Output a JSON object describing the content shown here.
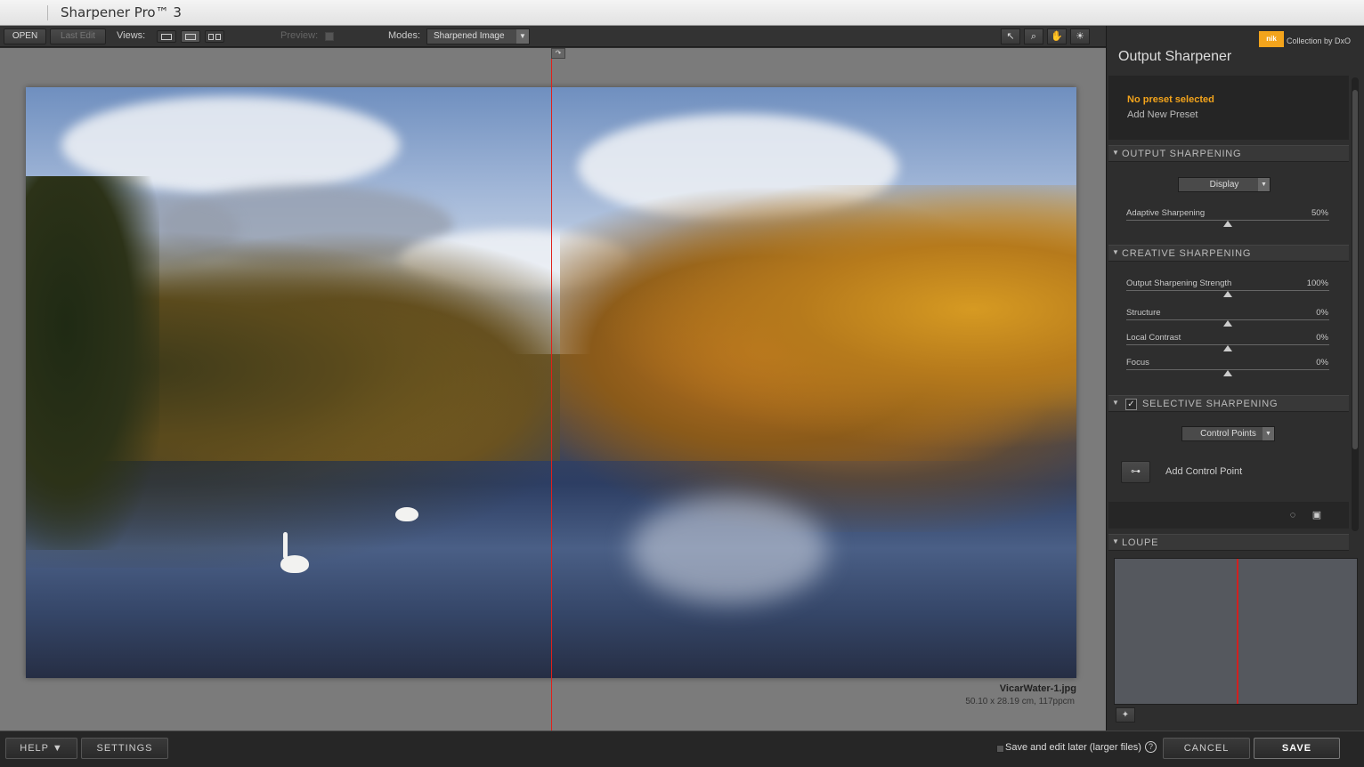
{
  "window": {
    "title": "Sharpener Pro™ 3"
  },
  "toolbar": {
    "open_label": "OPEN",
    "last_edit_label": "Last Edit",
    "views_label": "Views:",
    "preview_label": "Preview:",
    "modes_label": "Modes:",
    "modes_value": "Sharpened Image"
  },
  "canvas": {
    "file_name": "VicarWater-1.jpg",
    "file_info": "50.10 x 28.19 cm, 117ppcm"
  },
  "panel": {
    "brand_logo": "nik",
    "brand_collection": "Collection by DxO",
    "title": "Output Sharpener",
    "no_preset": "No preset selected",
    "add_preset": "Add New Preset",
    "output_sharpening": {
      "header": "OUTPUT SHARPENING",
      "select_value": "Display",
      "sliders": [
        {
          "label": "Adaptive Sharpening",
          "value": "50%",
          "fraction": 0.5
        }
      ]
    },
    "creative_sharpening": {
      "header": "CREATIVE SHARPENING",
      "sliders": [
        {
          "label": "Output Sharpening Strength",
          "value": "100%",
          "fraction": 0.5
        },
        {
          "label": "Structure",
          "value": "0%",
          "fraction": 0.5
        },
        {
          "label": "Local Contrast",
          "value": "0%",
          "fraction": 0.5
        },
        {
          "label": "Focus",
          "value": "0%",
          "fraction": 0.5
        }
      ]
    },
    "selective_sharpening": {
      "header": "SELECTIVE SHARPENING",
      "checked": true,
      "select_value": "Control Points",
      "add_control_point": "Add Control Point"
    },
    "loupe": {
      "header": "LOUPE"
    }
  },
  "bottombar": {
    "help_label": "HELP ▼",
    "settings_label": "SETTINGS",
    "save_later_label": "Save and edit later (larger files)",
    "cancel_label": "CANCEL",
    "save_label": "SAVE"
  },
  "colors": {
    "accent": "#f3a41c",
    "divider": "#e0201a"
  }
}
